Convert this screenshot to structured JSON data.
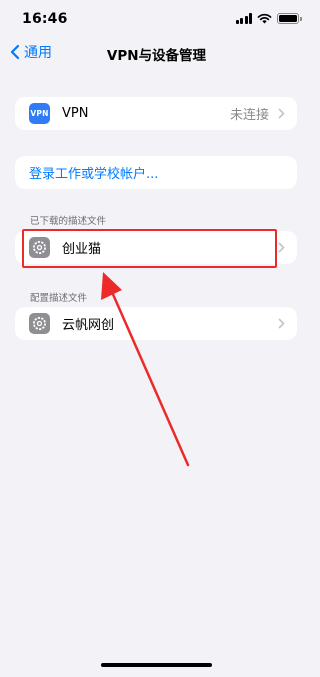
{
  "status_bar": {
    "time": "16:46"
  },
  "nav": {
    "back_label": "通用",
    "title": "VPN与设备管理"
  },
  "vpn_group": {
    "icon_text": "VPN",
    "label": "VPN",
    "value": "未连接"
  },
  "login_group": {
    "label": "登录工作或学校帐户..."
  },
  "downloaded_section": {
    "header": "已下载的描述文件",
    "item_label": "创业猫"
  },
  "config_section": {
    "header": "配置描述文件",
    "item_label": "云帆网创"
  },
  "colors": {
    "accent": "#007aff",
    "annotation": "#ec2a2a",
    "background": "#f2f2f7"
  }
}
